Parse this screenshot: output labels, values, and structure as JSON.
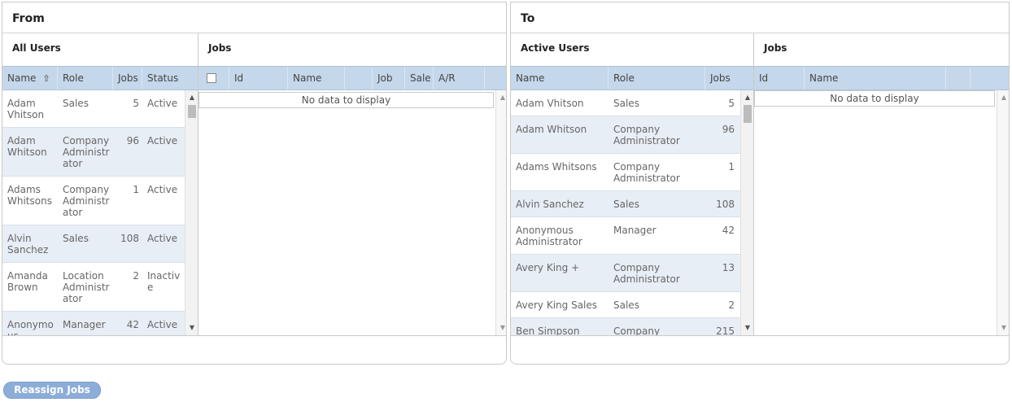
{
  "from": {
    "title": "From",
    "users": {
      "title": "All Users",
      "columns": {
        "name": "Name",
        "role": "Role",
        "jobs": "Jobs",
        "status": "Status"
      },
      "rows": [
        {
          "name": "Adam\nVhitson",
          "role": "Sales",
          "jobs": "5",
          "status": "Active"
        },
        {
          "name": "Adam\nWhitson",
          "role": "Company\nAdministr\nator",
          "jobs": "96",
          "status": "Active"
        },
        {
          "name": "Adams\nWhitsons",
          "role": "Company\nAdministr\nator",
          "jobs": "1",
          "status": "Active"
        },
        {
          "name": "Alvin\nSanchez",
          "role": "Sales",
          "jobs": "108",
          "status": "Active"
        },
        {
          "name": "Amanda\nBrown",
          "role": "Location\nAdministr\nator",
          "jobs": "2",
          "status": "Inactiv\ne"
        },
        {
          "name": "Anonymo\nus",
          "role": "Manager",
          "jobs": "42",
          "status": "Active"
        }
      ]
    },
    "jobs": {
      "title": "Jobs",
      "columns": {
        "id": "Id",
        "name": "Name",
        "job": "Job",
        "sale": "Sale",
        "ar": "A/R"
      },
      "empty_text": "No data to display"
    }
  },
  "to": {
    "title": "To",
    "users": {
      "title": "Active Users",
      "columns": {
        "name": "Name",
        "role": "Role",
        "jobs": "Jobs"
      },
      "rows": [
        {
          "name": "Adam Vhitson",
          "role": "Sales",
          "jobs": "5"
        },
        {
          "name": "Adam Whitson",
          "role": "Company\nAdministrator",
          "jobs": "96"
        },
        {
          "name": "Adams Whitsons",
          "role": "Company\nAdministrator",
          "jobs": "1"
        },
        {
          "name": "Alvin Sanchez",
          "role": "Sales",
          "jobs": "108"
        },
        {
          "name": "Anonymous\nAdministrator",
          "role": "Manager",
          "jobs": "42"
        },
        {
          "name": "Avery King +",
          "role": "Company\nAdministrator",
          "jobs": "13"
        },
        {
          "name": "Avery King Sales",
          "role": "Sales",
          "jobs": "2"
        },
        {
          "name": "Ben Simpson",
          "role": "Company\nAdministrator",
          "jobs": "215"
        }
      ]
    },
    "jobs": {
      "title": "Jobs",
      "columns": {
        "id": "Id",
        "name": "Name"
      },
      "empty_text": "No data to display"
    }
  },
  "actions": {
    "reassign_label": "Reassign Jobs"
  },
  "icons": {
    "sort": "sort-arrow-up-icon",
    "scroll_up": "scroll-up-arrow-icon",
    "scroll_down": "scroll-down-arrow-icon"
  }
}
